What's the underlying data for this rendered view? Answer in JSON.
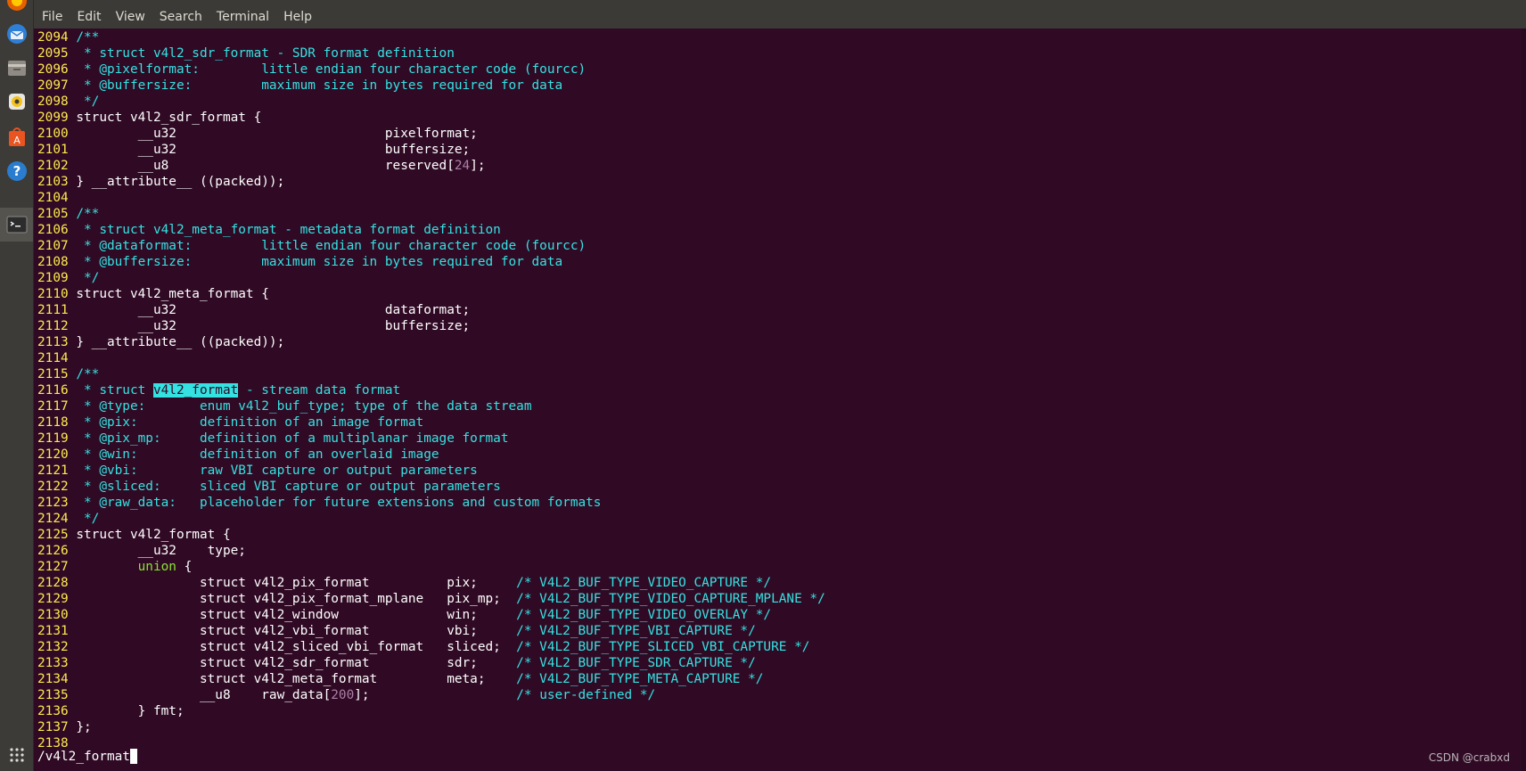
{
  "menubar": [
    "File",
    "Edit",
    "View",
    "Search",
    "Terminal",
    "Help"
  ],
  "dock": {
    "items": [
      {
        "name": "firefox-icon"
      },
      {
        "name": "thunderbird-icon"
      },
      {
        "name": "files-icon"
      },
      {
        "name": "rhythmbox-icon"
      },
      {
        "name": "software-center-icon"
      },
      {
        "name": "help-icon"
      },
      {
        "name": "terminal-icon",
        "active": true
      }
    ],
    "apps_grid": "show-applications-icon"
  },
  "terminal": {
    "lines": [
      {
        "n": "2094",
        "segs": [
          {
            "t": "/**",
            "c": "cyan"
          }
        ]
      },
      {
        "n": "2095",
        "segs": [
          {
            "t": " * struct v4l2_sdr_format - SDR format definition",
            "c": "cyan"
          }
        ]
      },
      {
        "n": "2096",
        "segs": [
          {
            "t": " * @pixelformat:        little endian four character code (fourcc)",
            "c": "cyan"
          }
        ]
      },
      {
        "n": "2097",
        "segs": [
          {
            "t": " * @buffersize:         maximum size in bytes required for data",
            "c": "cyan"
          }
        ]
      },
      {
        "n": "2098",
        "segs": [
          {
            "t": " */",
            "c": "cyan"
          }
        ]
      },
      {
        "n": "2099",
        "segs": [
          {
            "t": "struct v4l2_sdr_format {"
          }
        ]
      },
      {
        "n": "2100",
        "segs": [
          {
            "t": "        __u32                           pixelformat;"
          }
        ]
      },
      {
        "n": "2101",
        "segs": [
          {
            "t": "        __u32                           buffersize;"
          }
        ]
      },
      {
        "n": "2102",
        "segs": [
          {
            "t": "        __u8                            reserved["
          },
          {
            "t": "24",
            "c": "num"
          },
          {
            "t": "];"
          }
        ]
      },
      {
        "n": "2103",
        "segs": [
          {
            "t": "} __attribute__ ((packed));"
          }
        ]
      },
      {
        "n": "2104",
        "segs": []
      },
      {
        "n": "2105",
        "segs": [
          {
            "t": "/**",
            "c": "cyan"
          }
        ]
      },
      {
        "n": "2106",
        "segs": [
          {
            "t": " * struct v4l2_meta_format - metadata format definition",
            "c": "cyan"
          }
        ]
      },
      {
        "n": "2107",
        "segs": [
          {
            "t": " * @dataformat:         little endian four character code (fourcc)",
            "c": "cyan"
          }
        ]
      },
      {
        "n": "2108",
        "segs": [
          {
            "t": " * @buffersize:         maximum size in bytes required for data",
            "c": "cyan"
          }
        ]
      },
      {
        "n": "2109",
        "segs": [
          {
            "t": " */",
            "c": "cyan"
          }
        ]
      },
      {
        "n": "2110",
        "segs": [
          {
            "t": "struct v4l2_meta_format {"
          }
        ]
      },
      {
        "n": "2111",
        "segs": [
          {
            "t": "        __u32                           dataformat;"
          }
        ]
      },
      {
        "n": "2112",
        "segs": [
          {
            "t": "        __u32                           buffersize;"
          }
        ]
      },
      {
        "n": "2113",
        "segs": [
          {
            "t": "} __attribute__ ((packed));"
          }
        ]
      },
      {
        "n": "2114",
        "segs": []
      },
      {
        "n": "2115",
        "segs": [
          {
            "t": "/**",
            "c": "cyan"
          }
        ]
      },
      {
        "n": "2116",
        "segs": [
          {
            "t": " * struct ",
            "c": "cyan"
          },
          {
            "t": "v4l2_format",
            "c": "search"
          },
          {
            "t": " - stream data format",
            "c": "cyan"
          }
        ]
      },
      {
        "n": "2117",
        "segs": [
          {
            "t": " * @type:       enum v4l2_buf_type; type of the data stream",
            "c": "cyan"
          }
        ]
      },
      {
        "n": "2118",
        "segs": [
          {
            "t": " * @pix:        definition of an image format",
            "c": "cyan"
          }
        ]
      },
      {
        "n": "2119",
        "segs": [
          {
            "t": " * @pix_mp:     definition of a multiplanar image format",
            "c": "cyan"
          }
        ]
      },
      {
        "n": "2120",
        "segs": [
          {
            "t": " * @win:        definition of an overlaid image",
            "c": "cyan"
          }
        ]
      },
      {
        "n": "2121",
        "segs": [
          {
            "t": " * @vbi:        raw VBI capture or output parameters",
            "c": "cyan"
          }
        ]
      },
      {
        "n": "2122",
        "segs": [
          {
            "t": " * @sliced:     sliced VBI capture or output parameters",
            "c": "cyan"
          }
        ]
      },
      {
        "n": "2123",
        "segs": [
          {
            "t": " * @raw_data:   placeholder for future extensions and custom formats",
            "c": "cyan"
          }
        ]
      },
      {
        "n": "2124",
        "segs": [
          {
            "t": " */",
            "c": "cyan"
          }
        ]
      },
      {
        "n": "2125",
        "segs": [
          {
            "t": "struct v4l2_format {"
          }
        ]
      },
      {
        "n": "2126",
        "segs": [
          {
            "t": "        __u32    type;"
          }
        ]
      },
      {
        "n": "2127",
        "segs": [
          {
            "t": "        "
          },
          {
            "t": "union",
            "c": "kw"
          },
          {
            "t": " {"
          }
        ]
      },
      {
        "n": "2128",
        "segs": [
          {
            "t": "                struct v4l2_pix_format          pix;     "
          },
          {
            "t": "/* V4L2_BUF_TYPE_VIDEO_CAPTURE */",
            "c": "cyan"
          }
        ]
      },
      {
        "n": "2129",
        "segs": [
          {
            "t": "                struct v4l2_pix_format_mplane   pix_mp;  "
          },
          {
            "t": "/* V4L2_BUF_TYPE_VIDEO_CAPTURE_MPLANE */",
            "c": "cyan"
          }
        ]
      },
      {
        "n": "2130",
        "segs": [
          {
            "t": "                struct v4l2_window              win;     "
          },
          {
            "t": "/* V4L2_BUF_TYPE_VIDEO_OVERLAY */",
            "c": "cyan"
          }
        ]
      },
      {
        "n": "2131",
        "segs": [
          {
            "t": "                struct v4l2_vbi_format          vbi;     "
          },
          {
            "t": "/* V4L2_BUF_TYPE_VBI_CAPTURE */",
            "c": "cyan"
          }
        ]
      },
      {
        "n": "2132",
        "segs": [
          {
            "t": "                struct v4l2_sliced_vbi_format   sliced;  "
          },
          {
            "t": "/* V4L2_BUF_TYPE_SLICED_VBI_CAPTURE */",
            "c": "cyan"
          }
        ]
      },
      {
        "n": "2133",
        "segs": [
          {
            "t": "                struct v4l2_sdr_format          sdr;     "
          },
          {
            "t": "/* V4L2_BUF_TYPE_SDR_CAPTURE */",
            "c": "cyan"
          }
        ]
      },
      {
        "n": "2134",
        "segs": [
          {
            "t": "                struct v4l2_meta_format         meta;    "
          },
          {
            "t": "/* V4L2_BUF_TYPE_META_CAPTURE */",
            "c": "cyan"
          }
        ]
      },
      {
        "n": "2135",
        "segs": [
          {
            "t": "                __u8    raw_data["
          },
          {
            "t": "200",
            "c": "num"
          },
          {
            "t": "];                   "
          },
          {
            "t": "/* user-defined */",
            "c": "cyan"
          }
        ]
      },
      {
        "n": "2136",
        "segs": [
          {
            "t": "        } fmt;"
          }
        ]
      },
      {
        "n": "2137",
        "segs": [
          {
            "t": "};"
          }
        ]
      },
      {
        "n": "2138",
        "segs": []
      }
    ],
    "command_line": "/v4l2_format"
  },
  "watermark": "CSDN @crabxd",
  "colors": {
    "background": "#300a24",
    "line_number": "#fce94f",
    "comment": "#34e2e2",
    "number": "#ad7fa8",
    "keyword": "#8ae234",
    "search_highlight": "#34e2e2"
  }
}
